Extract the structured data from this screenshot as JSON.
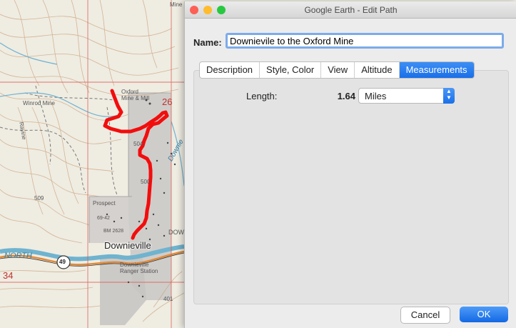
{
  "map": {
    "labels": {
      "oxford_mine": "Oxford\nMine & Mill",
      "winrod_mine": "Winrod Mine",
      "ravine": "Ravine",
      "prospect": "Prospect",
      "bm": "BM 2628",
      "downieville": "Downieville",
      "downieville_partial": "DOWNI",
      "ranger": "Downieville\nRanger Station",
      "north": "NORTH",
      "section_26": "26",
      "section_34": "34",
      "road_49": "49",
      "road_504": "504",
      "road_500": "500",
      "road_509": "509",
      "road_401": "401",
      "road_69_42": "69-42",
      "mine_top": "Mine",
      "downie_river": "Downie"
    },
    "path_color": "#f20d0d"
  },
  "window": {
    "title": "Google Earth - Edit Path",
    "controls": {
      "close_color": "#fd5f57",
      "minimize_color": "#febc2e",
      "zoom_color": "#28c840"
    }
  },
  "form": {
    "name_label": "Name:",
    "name_value": "Downievile to the Oxford Mine"
  },
  "tabs": [
    {
      "label": "Description",
      "active": false
    },
    {
      "label": "Style, Color",
      "active": false
    },
    {
      "label": "View",
      "active": false
    },
    {
      "label": "Altitude",
      "active": false
    },
    {
      "label": "Measurements",
      "active": true
    }
  ],
  "measurements": {
    "length_label": "Length:",
    "length_value": "1.64",
    "units_value": "Miles"
  },
  "buttons": {
    "cancel": "Cancel",
    "ok": "OK"
  }
}
